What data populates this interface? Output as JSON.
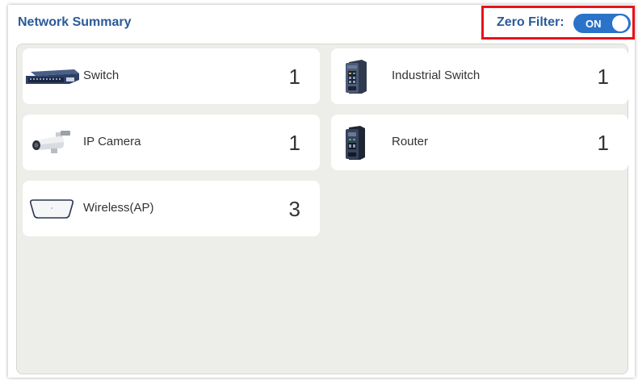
{
  "header": {
    "title": "Network Summary",
    "zero_filter_label": "Zero Filter:",
    "toggle_state": "ON"
  },
  "devices": [
    {
      "label": "Switch",
      "count": "1",
      "icon": "switch-icon"
    },
    {
      "label": "Industrial Switch",
      "count": "1",
      "icon": "industrial-switch-icon"
    },
    {
      "label": "IP Camera",
      "count": "1",
      "icon": "ip-camera-icon"
    },
    {
      "label": "Router",
      "count": "1",
      "icon": "router-icon"
    },
    {
      "label": "Wireless(AP)",
      "count": "3",
      "icon": "wireless-ap-icon"
    }
  ],
  "colors": {
    "title": "#2a5a99",
    "toggle": "#2a73c9",
    "highlight": "#e8121a",
    "content_bg": "#edeee9"
  }
}
